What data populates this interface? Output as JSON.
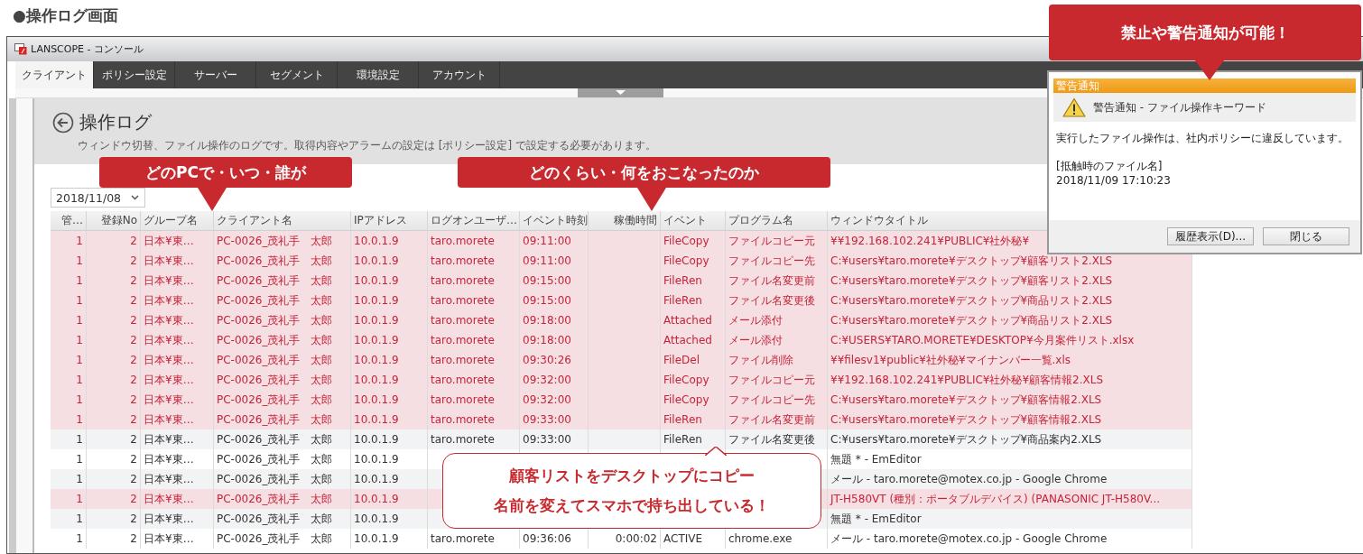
{
  "heading": "●操作ログ画面",
  "window": {
    "title": "LANSCOPE - コンソール"
  },
  "tabs": [
    {
      "label": "クライアント",
      "selected": true
    },
    {
      "label": "ポリシー設定",
      "selected": false
    },
    {
      "label": "サーバー",
      "selected": false
    },
    {
      "label": "セグメント",
      "selected": false
    },
    {
      "label": "環境設定",
      "selected": false
    },
    {
      "label": "アカウント",
      "selected": false
    }
  ],
  "page": {
    "title": "操作ログ",
    "description": "ウィンドウ切替、ファイル操作のログです。取得内容やアラームの設定は [ポリシー設定] で設定する必要があります。"
  },
  "date_filter": {
    "value": "2018/11/08"
  },
  "table": {
    "columns": [
      "管…",
      "登録No",
      "グループ名",
      "クライアント名",
      "IPアドレス",
      "ログオンユーザ…",
      "イベント時刻",
      "稼働時間",
      "イベント",
      "プログラム名",
      "ウィンドウタイトル"
    ],
    "rows": [
      {
        "alert": true,
        "cells": [
          "1",
          "2",
          "日本¥東…",
          "PC-0026_茂礼手　太郎",
          "10.0.1.9",
          "taro.morete",
          "09:11:00",
          null,
          "FileCopy",
          "ファイルコピー元",
          "¥¥192.168.102.241¥PUBLIC¥社外秘¥"
        ]
      },
      {
        "alert": true,
        "cells": [
          "1",
          "2",
          "日本¥東…",
          "PC-0026_茂礼手　太郎",
          "10.0.1.9",
          "taro.morete",
          "09:11:00",
          null,
          "FileCopy",
          "ファイルコピー先",
          "C:¥users¥taro.morete¥デスクトップ¥顧客リスト2.XLS"
        ]
      },
      {
        "alert": true,
        "cells": [
          "1",
          "2",
          "日本¥東…",
          "PC-0026_茂礼手　太郎",
          "10.0.1.9",
          "taro.morete",
          "09:15:00",
          null,
          "FileRen",
          "ファイル名変更前",
          "C:¥users¥taro.morete¥デスクトップ¥顧客リスト2.XLS"
        ]
      },
      {
        "alert": true,
        "cells": [
          "1",
          "2",
          "日本¥東…",
          "PC-0026_茂礼手　太郎",
          "10.0.1.9",
          "taro.morete",
          "09:15:00",
          null,
          "FileRen",
          "ファイル名変更後",
          "C:¥users¥taro.morete¥デスクトップ¥商品リスト2.XLS"
        ]
      },
      {
        "alert": true,
        "cells": [
          "1",
          "2",
          "日本¥東…",
          "PC-0026_茂礼手　太郎",
          "10.0.1.9",
          "taro.morete",
          "09:18:00",
          null,
          "Attached",
          "メール添付",
          "C:¥users¥taro.morete¥デスクトップ¥商品リスト2.XLS"
        ]
      },
      {
        "alert": true,
        "cells": [
          "1",
          "2",
          "日本¥東…",
          "PC-0026_茂礼手　太郎",
          "10.0.1.9",
          "taro.morete",
          "09:18:00",
          null,
          "Attached",
          "メール添付",
          "C:¥USERS¥TARO.MORETE¥DESKTOP¥今月案件リスト.xlsx"
        ]
      },
      {
        "alert": true,
        "cells": [
          "1",
          "2",
          "日本¥東…",
          "PC-0026_茂礼手　太郎",
          "10.0.1.9",
          "taro.morete",
          "09:30:26",
          null,
          "FileDel",
          "ファイル削除",
          "¥¥filesv1¥public¥社外秘¥マイナンバー一覧.xls"
        ]
      },
      {
        "alert": true,
        "cells": [
          "1",
          "2",
          "日本¥東…",
          "PC-0026_茂礼手　太郎",
          "10.0.1.9",
          "taro.morete",
          "09:32:00",
          null,
          "FileCopy",
          "ファイルコピー元",
          "¥¥192.168.102.241¥PUBLIC¥社外秘¥顧客情報2.XLS"
        ]
      },
      {
        "alert": true,
        "cells": [
          "1",
          "2",
          "日本¥東…",
          "PC-0026_茂礼手　太郎",
          "10.0.1.9",
          "taro.morete",
          "09:32:00",
          null,
          "FileCopy",
          "ファイルコピー先",
          "C:¥users¥taro.morete¥デスクトップ¥顧客情報2.XLS"
        ]
      },
      {
        "alert": true,
        "cells": [
          "1",
          "2",
          "日本¥東…",
          "PC-0026_茂礼手　太郎",
          "10.0.1.9",
          "taro.morete",
          "09:33:00",
          null,
          "FileRen",
          "ファイル名変更前",
          "C:¥users¥taro.morete¥デスクトップ¥顧客情報2.XLS"
        ]
      },
      {
        "alert": false,
        "cells": [
          "1",
          "2",
          "日本¥東…",
          "PC-0026_茂礼手　太郎",
          "10.0.1.9",
          "taro.morete",
          "09:33:00",
          null,
          "FileRen",
          "ファイル名変更後",
          "C:¥users¥taro.morete¥デスクトップ¥商品案内2.XLS"
        ]
      },
      {
        "alert": false,
        "cells": [
          "1",
          "2",
          "日本¥東…",
          "PC-0026_茂礼手　太郎",
          "10.0.1.9",
          null,
          null,
          null,
          null,
          null,
          "無題 * - EmEditor"
        ]
      },
      {
        "alert": false,
        "cells": [
          "1",
          "2",
          "日本¥東…",
          "PC-0026_茂礼手　太郎",
          "10.0.1.9",
          null,
          null,
          null,
          null,
          null,
          "メール - taro.morete@motex.co.jp - Google Chrome"
        ]
      },
      {
        "alert": true,
        "cells": [
          "1",
          "2",
          "日本¥東…",
          "PC-0026_茂礼手　太郎",
          "10.0.1.9",
          null,
          null,
          null,
          null,
          null,
          "JT-H580VT (種別：ポータブルデバイス) (PANASONIC JT-H580V..."
        ]
      },
      {
        "alert": false,
        "cells": [
          "1",
          "2",
          "日本¥東…",
          "PC-0026_茂礼手　太郎",
          "10.0.1.9",
          null,
          null,
          null,
          null,
          null,
          "無題 * - EmEditor"
        ]
      },
      {
        "alert": false,
        "cells": [
          "1",
          "2",
          "日本¥東…",
          "PC-0026_茂礼手　太郎",
          "10.0.1.9",
          "taro.morete",
          "09:36:06",
          "0:00:02",
          "ACTIVE",
          "chrome.exe",
          "メール - taro.morete@motex.co.jp - Google Chrome"
        ]
      }
    ]
  },
  "callouts": [
    {
      "kind": "banner",
      "lines": [
        "どのPCで・いつ・誰が"
      ]
    },
    {
      "kind": "banner",
      "lines": [
        "どのくらい・何をおこなったのか"
      ]
    },
    {
      "kind": "banner",
      "lines": [
        "禁止や警告通知が可能！"
      ]
    },
    {
      "kind": "bubble",
      "lines": [
        "顧客リストをデスクトップにコピー",
        "名前を変えてスマホで持ち出している！"
      ]
    }
  ],
  "warning_dialog": {
    "title": "警告通知",
    "heading": "警告通知 - ファイル操作キーワード",
    "message": "実行したファイル操作は、社内ポリシーに違反しています。",
    "file_label": "[抵触時のファイル名]",
    "timestamp": "2018/11/09 17:10:23",
    "buttons": [
      "履歴表示(D)...",
      "閉じる"
    ]
  }
}
